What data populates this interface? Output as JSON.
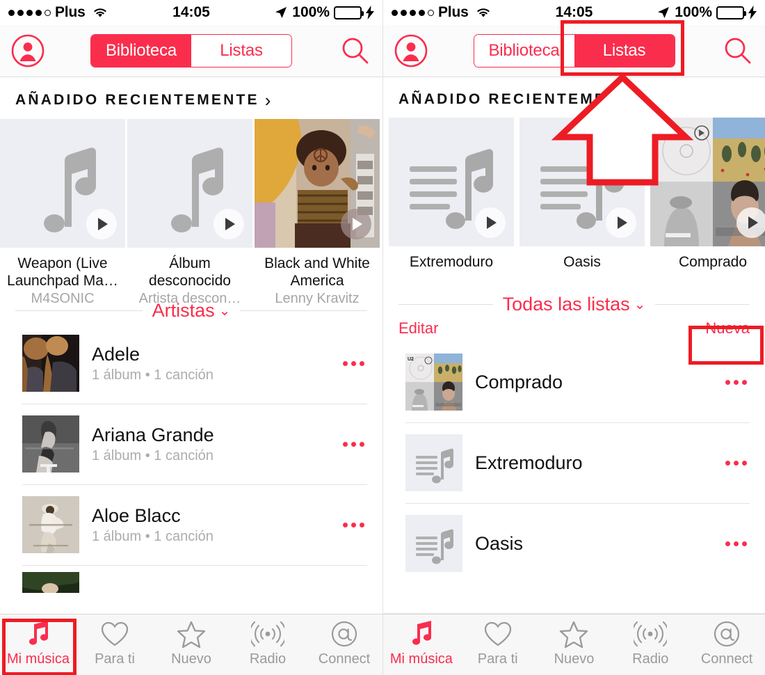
{
  "status_bar": {
    "signal_dots": 5,
    "signal_filled": 4,
    "carrier": "Plus",
    "wifi_icon": "wifi-icon",
    "time": "14:05",
    "location_icon": "location-arrow-icon",
    "battery_percent": "100%",
    "battery_fill": 100,
    "charging_icon": "lightning-bolt-icon"
  },
  "colors": {
    "accent": "#fa2d4d",
    "annotation": "#ed1c24",
    "battery_green": "#4cd964",
    "placeholder_gray": "#eceef3",
    "subtext_gray": "#acacac"
  },
  "left_panel": {
    "nav": {
      "avatar_icon": "account-avatar-icon",
      "search_icon": "search-icon",
      "segments": [
        {
          "label": "Biblioteca",
          "active": true
        },
        {
          "label": "Listas",
          "active": false
        }
      ]
    },
    "section": {
      "title": "AÑADIDO RECIENTEMENTE",
      "chevron": "›"
    },
    "recently_added": [
      {
        "title": "Weapon (Live\nLaunchpad Ma…",
        "title_line1": "Weapon (Live",
        "title_line2": "Launchpad Ma…",
        "artist": "M4SONIC",
        "art": "placeholder-note"
      },
      {
        "title_line1": "Álbum",
        "title_line2": "desconocido",
        "artist": "Artista descon…",
        "art": "placeholder-note"
      },
      {
        "title_line1": "Black and White",
        "title_line2": "America",
        "artist": "Lenny Kravitz",
        "art": "photo-kravitz"
      }
    ],
    "divider": {
      "label": "Artistas",
      "chevron": "⌄"
    },
    "artists": [
      {
        "name": "Adele",
        "sub": "1 álbum • 1 canción",
        "art": "photo-adele"
      },
      {
        "name": "Ariana Grande",
        "sub": "1 álbum • 1 canción",
        "art": "photo-ariana"
      },
      {
        "name": "Aloe Blacc",
        "sub": "1 álbum • 1 canción",
        "art": "photo-aloeblacc"
      }
    ],
    "tabs": [
      {
        "label": "Mi música",
        "icon": "music-note-icon",
        "active": true
      },
      {
        "label": "Para ti",
        "icon": "heart-icon",
        "active": false
      },
      {
        "label": "Nuevo",
        "icon": "star-icon",
        "active": false
      },
      {
        "label": "Radio",
        "icon": "radio-waves-icon",
        "active": false
      },
      {
        "label": "Connect",
        "icon": "at-sign-icon",
        "active": false
      }
    ]
  },
  "right_panel": {
    "nav": {
      "avatar_icon": "account-avatar-icon",
      "search_icon": "search-icon",
      "segments": [
        {
          "label": "Biblioteca",
          "active": false
        },
        {
          "label": "Listas",
          "active": true
        }
      ]
    },
    "section": {
      "title": "AÑADIDO RECIENTEMENTE"
    },
    "recently_added": [
      {
        "title": "Extremoduro",
        "art": "placeholder-playlist"
      },
      {
        "title": "Oasis",
        "art": "placeholder-playlist"
      },
      {
        "title": "Comprado",
        "art": "collage-4up"
      }
    ],
    "divider": {
      "label": "Todas las listas",
      "chevron": "⌄"
    },
    "edit_label": "Editar",
    "new_label": "Nueva",
    "playlists": [
      {
        "name": "Comprado",
        "art": "collage-4up"
      },
      {
        "name": "Extremoduro",
        "art": "placeholder-playlist"
      },
      {
        "name": "Oasis",
        "art": "placeholder-playlist"
      }
    ],
    "tabs": [
      {
        "label": "Mi música",
        "icon": "music-note-icon",
        "active": true
      },
      {
        "label": "Para ti",
        "icon": "heart-icon",
        "active": false
      },
      {
        "label": "Nuevo",
        "icon": "star-icon",
        "active": false
      },
      {
        "label": "Radio",
        "icon": "radio-waves-icon",
        "active": false
      },
      {
        "label": "Connect",
        "icon": "at-sign-icon",
        "active": false
      }
    ]
  },
  "annotations": [
    {
      "name": "highlight-listas-tab",
      "target": "Listas"
    },
    {
      "name": "highlight-nueva-button",
      "target": "Nueva"
    },
    {
      "name": "highlight-mi-musica-tab",
      "target": "Mi música"
    },
    {
      "name": "pointer-arrow-to-listas",
      "target": "Listas"
    }
  ]
}
